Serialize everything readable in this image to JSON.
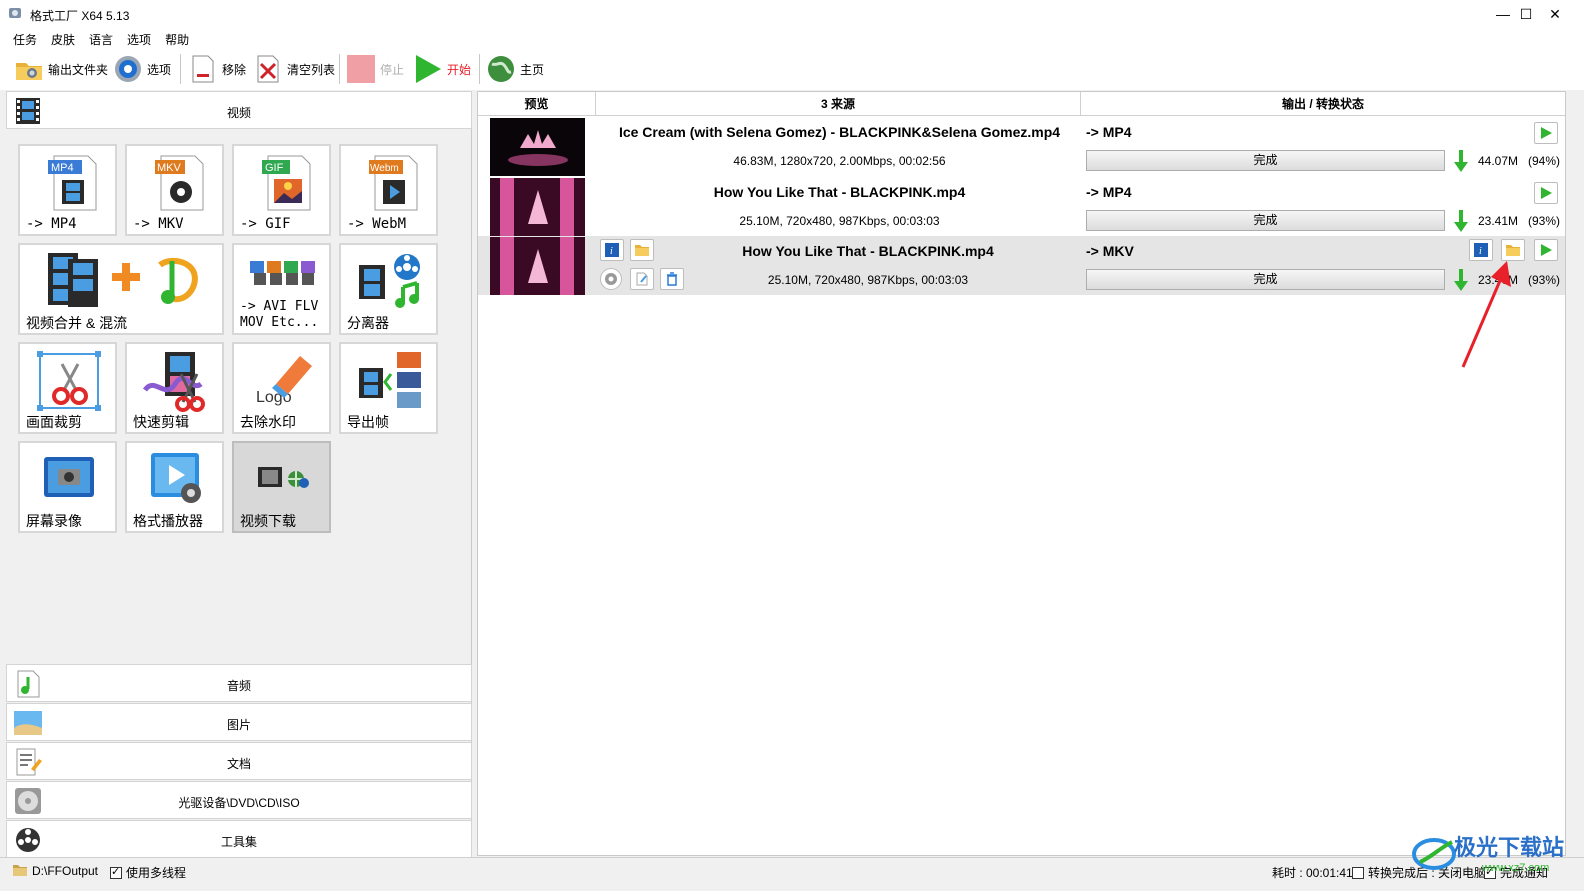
{
  "window": {
    "title": "格式工厂 X64 5.13",
    "minimize": "—",
    "maximize": "☐",
    "close": "✕"
  },
  "menu": [
    "任务",
    "皮肤",
    "语言",
    "选项",
    "帮助"
  ],
  "toolbar": {
    "output_folder": "输出文件夹",
    "options": "选项",
    "remove": "移除",
    "clear_list": "清空列表",
    "stop": "停止",
    "start": "开始",
    "home": "主页"
  },
  "left": {
    "video_header": "视频",
    "tiles": [
      {
        "badge": "MP4",
        "label": "-> MP4"
      },
      {
        "badge": "MKV",
        "label": "-> MKV"
      },
      {
        "badge": "GIF",
        "label": "-> GIF"
      },
      {
        "badge": "Webm",
        "label": "-> WebM"
      },
      {
        "label": "视频合并 & 混流"
      },
      {
        "label": "-> AVI FLV\nMOV Etc..."
      },
      {
        "label": "分离器"
      },
      {
        "label": "画面裁剪"
      },
      {
        "label": "快速剪辑"
      },
      {
        "label": "去除水印",
        "logo_text": "Logo"
      },
      {
        "label": "导出帧"
      },
      {
        "label": "屏幕录像"
      },
      {
        "label": "格式播放器"
      },
      {
        "label": "视频下载"
      }
    ],
    "categories": [
      "音频",
      "图片",
      "文档",
      "光驱设备\\DVD\\CD\\ISO",
      "工具集"
    ]
  },
  "table": {
    "headers": {
      "preview": "预览",
      "source": "3 来源",
      "output": "输出 / 转换状态"
    },
    "rows": [
      {
        "name": "Ice Cream (with Selena Gomez) - BLACKPINK&Selena Gomez.mp4",
        "info": "46.83M, 1280x720, 2.00Mbps, 00:02:56",
        "format": "-> MP4",
        "status": "完成",
        "size": "44.07M",
        "pct": "(94%)"
      },
      {
        "name": "How You Like That - BLACKPINK.mp4",
        "info": "25.10M, 720x480, 987Kbps, 00:03:03",
        "format": "-> MP4",
        "status": "完成",
        "size": "23.41M",
        "pct": "(93%)"
      },
      {
        "name": "How You Like That - BLACKPINK.mp4",
        "info": "25.10M, 720x480, 987Kbps, 00:03:03",
        "format": "-> MKV",
        "status": "完成",
        "size": "23.46M",
        "pct": "(93%)"
      }
    ]
  },
  "status": {
    "path": "D:\\FFOutput",
    "multithread": "使用多线程",
    "elapsed": "耗时 : 00:01:41",
    "after_done": "转换完成后 : 关闭电脑",
    "notify": "完成通知"
  },
  "watermark": {
    "text": "极光下载站",
    "url": "www.xz7.com"
  },
  "colors": {
    "accent_red": "#e8202a",
    "play_green": "#2fb52f",
    "pink_thumb": "#d7559a"
  }
}
